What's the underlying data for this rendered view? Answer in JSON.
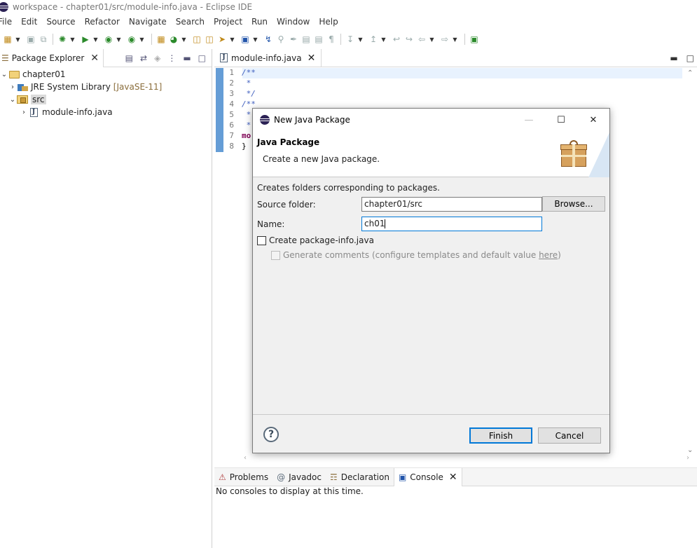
{
  "window": {
    "title": "workspace - chapter01/src/module-info.java - Eclipse IDE"
  },
  "menu": [
    "File",
    "Edit",
    "Source",
    "Refactor",
    "Navigate",
    "Search",
    "Project",
    "Run",
    "Window",
    "Help"
  ],
  "package_explorer": {
    "tab_label": "Package Explorer",
    "tree": {
      "project": "chapter01",
      "jre_library": "JRE System Library",
      "jre_decoration": "[JavaSE-11]",
      "src_folder": "src",
      "file": "module-info.java"
    }
  },
  "editor": {
    "tab_label": "module-info.java",
    "lines": [
      {
        "num": "1",
        "text": "/**"
      },
      {
        "num": "2",
        "text": " *"
      },
      {
        "num": "3",
        "text": " */"
      },
      {
        "num": "4",
        "text": "/**"
      },
      {
        "num": "5",
        "text": " *"
      },
      {
        "num": "6",
        "text": " *"
      },
      {
        "num": "7",
        "text": "mo"
      },
      {
        "num": "8",
        "text": "}"
      }
    ]
  },
  "bottom_panel": {
    "tabs": [
      "Problems",
      "Javadoc",
      "Declaration",
      "Console"
    ],
    "console_message": "No consoles to display at this time."
  },
  "dialog": {
    "title": "New Java Package",
    "heading": "Java Package",
    "description": "Create a new Java package.",
    "info": "Creates folders corresponding to packages.",
    "source_folder_label": "Source folder:",
    "source_folder_value": "chapter01/src",
    "browse_label": "Browse...",
    "name_label": "Name:",
    "name_value": "ch01",
    "create_package_info_label": "Create package-info.java",
    "generate_comments_label": "Generate comments (configure templates and default value ",
    "generate_comments_link": "here",
    "generate_comments_tail": ")",
    "finish_label": "Finish",
    "cancel_label": "Cancel",
    "help_symbol": "?"
  }
}
